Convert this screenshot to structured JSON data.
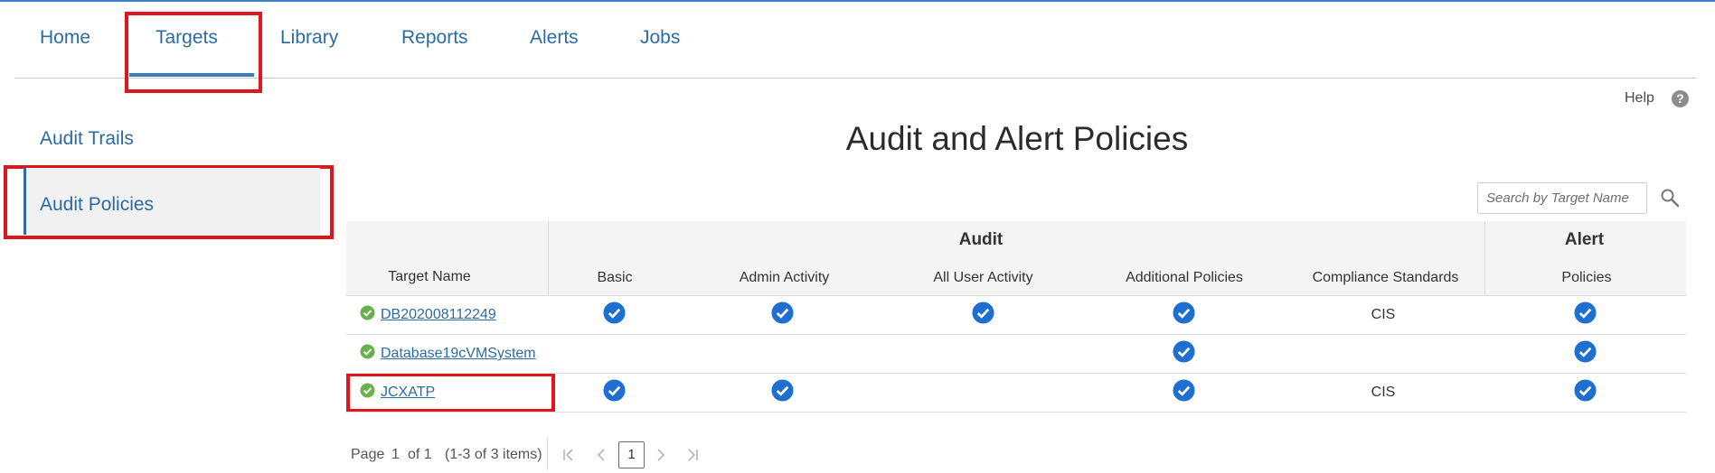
{
  "nav": {
    "items": [
      "Home",
      "Targets",
      "Library",
      "Reports",
      "Alerts",
      "Jobs"
    ],
    "active": "Targets"
  },
  "sidebar": {
    "items": [
      "Audit Trails",
      "Audit Policies"
    ],
    "active": "Audit Policies"
  },
  "help": {
    "label": "Help",
    "icon_glyph": "?"
  },
  "page": {
    "title": "Audit and Alert Policies"
  },
  "search": {
    "placeholder": "Search by Target Name",
    "icon": "search-icon"
  },
  "table": {
    "group_headers": {
      "audit": "Audit",
      "alert": "Alert"
    },
    "columns": {
      "target_name": "Target Name",
      "basic": "Basic",
      "admin_activity": "Admin Activity",
      "all_user_activity": "All User Activity",
      "additional_policies": "Additional Policies",
      "compliance_standards": "Compliance Standards",
      "policies": "Policies"
    },
    "rows": [
      {
        "target_name": "DB202008112249",
        "status": "active",
        "basic": true,
        "admin_activity": true,
        "all_user_activity": true,
        "additional_policies": true,
        "compliance_standards": "CIS",
        "alert_policies": true
      },
      {
        "target_name": "Database19cVMSystem",
        "status": "active",
        "basic": false,
        "admin_activity": false,
        "all_user_activity": false,
        "additional_policies": true,
        "compliance_standards": "",
        "alert_policies": true
      },
      {
        "target_name": "JCXATP",
        "status": "active",
        "basic": true,
        "admin_activity": true,
        "all_user_activity": false,
        "additional_policies": true,
        "compliance_standards": "CIS",
        "alert_policies": true
      }
    ]
  },
  "pagination": {
    "page_label": "Page",
    "current_page": "1",
    "of_label": "of 1",
    "items_summary": "(1-3 of 3 items)",
    "page_button": "1"
  },
  "colors": {
    "accent": "#2d6ca2",
    "highlight": "#e0161e",
    "check": "#1e6fd0",
    "status_ok": "#6ab04c"
  }
}
